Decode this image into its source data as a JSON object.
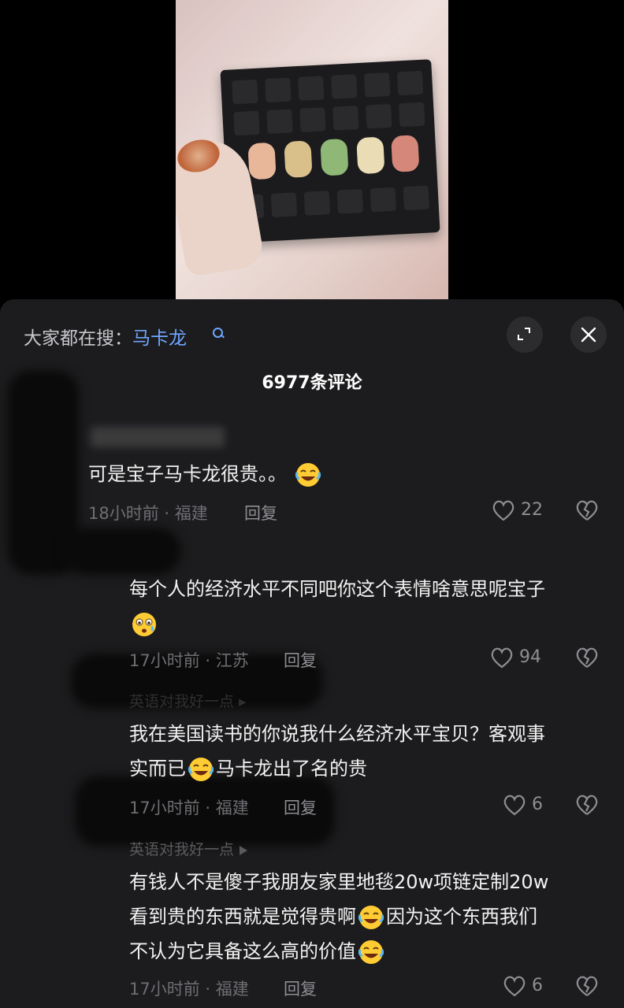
{
  "search": {
    "prefix": "大家都在搜：",
    "term": "马卡龙"
  },
  "header": {
    "comment_count": "6977条评论"
  },
  "comments": [
    {
      "text": "可是宝子马卡龙很贵。。",
      "time": "18小时前 · 福建",
      "reply_label": "回复",
      "likes": "22",
      "emoji": "laughing-tears-emoji"
    },
    {
      "text": "每个人的经济水平不同吧你这个表情啥意思呢宝子",
      "time": "17小时前 · 江苏",
      "reply_label": "回复",
      "likes": "94",
      "emoji": "worried-face-emoji"
    },
    {
      "reply_to": "英语对我好一点",
      "line1": "我在美国读书的你说我什么经济水平宝贝？客观事",
      "line2a": "实而已",
      "line2b": "马卡龙出了名的贵",
      "time": "17小时前 · 福建",
      "reply_label": "回复",
      "likes": "6",
      "emoji": "laughing-tears-emoji"
    },
    {
      "reply_to": "英语对我好一点",
      "line1": "有钱人不是傻子我朋友家里地毯20w项链定制20w",
      "line2a": "看到贵的东西就是觉得贵啊",
      "line2b": "因为这个东西我们",
      "line3": "不认为它具备这么高的价值",
      "time": "17小时前 · 福建",
      "reply_label": "回复",
      "likes": "6",
      "emoji": "laughing-tears-emoji"
    }
  ],
  "colors": {
    "accent": "#6fa6ff",
    "sheet_bg": "#1c1c1e",
    "meta_text": "#6e6e73"
  },
  "icons": [
    "search-icon",
    "expand-icon",
    "close-icon",
    "heart-icon",
    "broken-heart-icon",
    "play-arrow-icon"
  ]
}
